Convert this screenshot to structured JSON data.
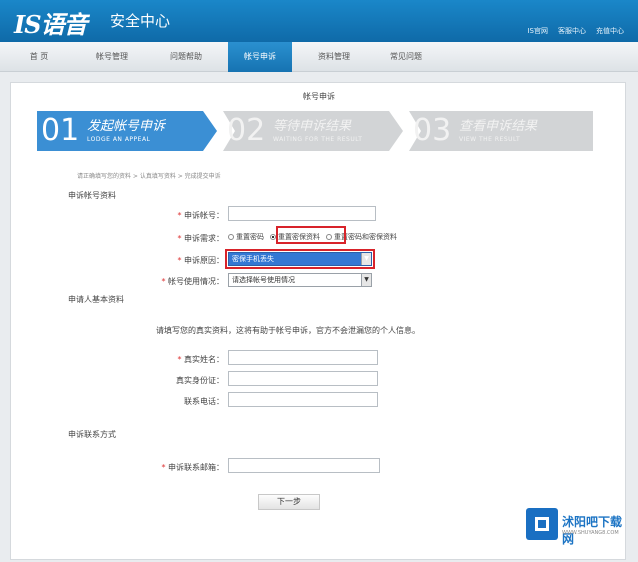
{
  "header": {
    "logo": "IS语音",
    "subtitle": "安全中心",
    "links": [
      "IS官网",
      "客服中心",
      "充值中心"
    ]
  },
  "nav": {
    "tabs": [
      {
        "label": "首 页",
        "active": false
      },
      {
        "label": "帐号管理",
        "active": false
      },
      {
        "label": "问题帮助",
        "active": false
      },
      {
        "label": "帐号申诉",
        "active": true
      },
      {
        "label": "资料管理",
        "active": false
      },
      {
        "label": "常见问题",
        "active": false
      }
    ]
  },
  "page": {
    "title": "帐号申诉",
    "breadcrumb": "请正确填写您的资料 > 认真填写资料 > 完成提交申诉"
  },
  "steps": [
    {
      "num": "01",
      "title": "发起帐号申诉",
      "sub": "LODGE AN APPEAL"
    },
    {
      "num": "02",
      "title": "等待申诉结果",
      "sub": "WAITING FOR THE RESULT"
    },
    {
      "num": "03",
      "title": "查看申诉结果",
      "sub": "VIEW THE RESULT"
    }
  ],
  "account_section": {
    "heading": "申诉帐号资料",
    "account_label": "申诉帐号：",
    "demand_label": "申诉需求：",
    "demand_options": [
      "重置密码",
      "重置密保资料",
      "重置密码和密保资料"
    ],
    "demand_selected": 1,
    "reason_label": "申诉原因：",
    "reason_value": "密保手机丢失",
    "usage_label": "帐号使用情况：",
    "usage_value": "请选择帐号使用情况"
  },
  "personal_section": {
    "heading": "申请人基本资料",
    "notice": "请填写您的真实资料，这将有助于帐号申诉，官方不会泄漏您的个人信息。",
    "name_label": "真实姓名：",
    "id_label": "真实身份证：",
    "phone_label": "联系电话："
  },
  "contact_section": {
    "heading": "申诉联系方式",
    "email_label": "申诉联系邮箱："
  },
  "actions": {
    "next": "下一步"
  },
  "watermark": {
    "text": "沭阳吧下载网",
    "url": "WWW.SHUYANG8.COM"
  },
  "colors": {
    "brand": "#1478bd",
    "highlight": "#d8232a",
    "active_step": "#3b8fd4",
    "inactive_step": "#d2d4d6"
  }
}
